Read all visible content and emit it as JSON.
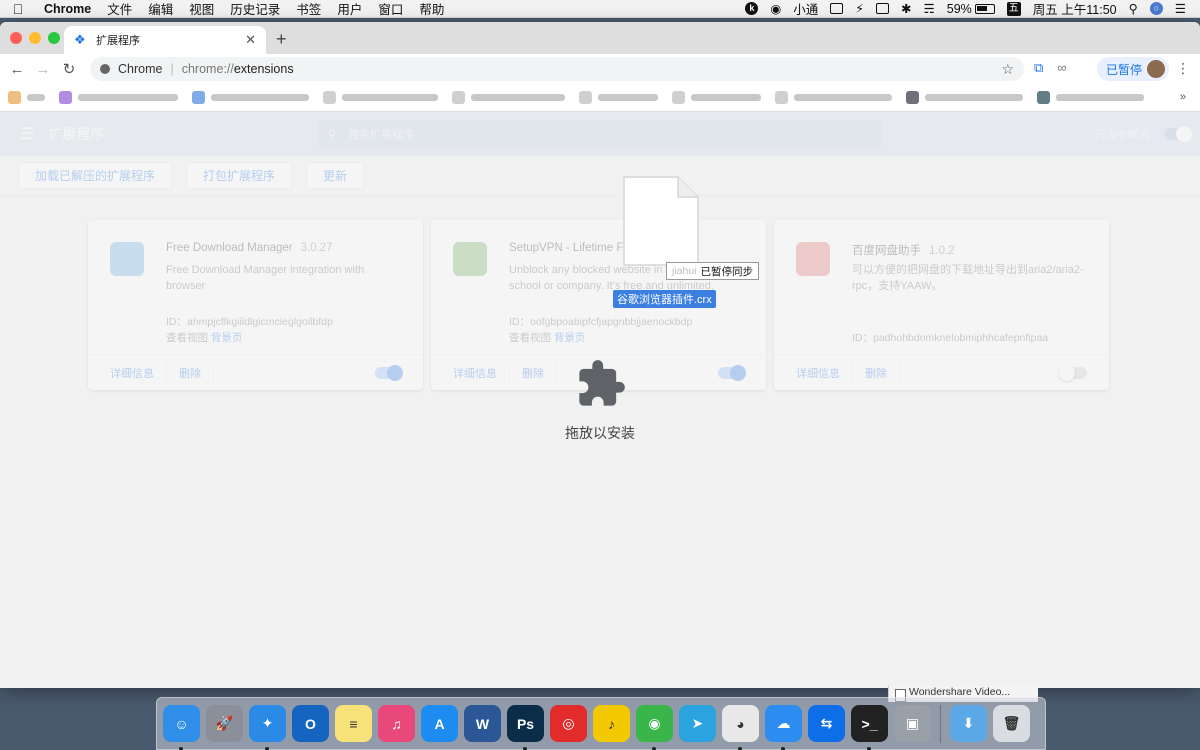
{
  "menubar": {
    "app_name": "Chrome",
    "items": [
      "文件",
      "编辑",
      "视图",
      "历史记录",
      "书签",
      "用户",
      "窗口",
      "帮助"
    ],
    "status": {
      "assistant_label": "小通",
      "battery": "59%",
      "ime_char": "五",
      "datetime": "周五 上午11:50"
    }
  },
  "browser": {
    "tab": {
      "title": "扩展程序"
    },
    "omnibox": {
      "chip": "Chrome",
      "url_scheme": "chrome://",
      "url_host": "extensions"
    },
    "profile": {
      "label": "已暂停"
    },
    "bookmarks_overflow": "»"
  },
  "extensions_page": {
    "header_title": "扩展程序",
    "search_placeholder": "搜索扩展程序",
    "developer_mode_label": "开发者模式",
    "actions": [
      "加载已解压的扩展程序",
      "打包扩展程序",
      "更新"
    ],
    "cards": [
      {
        "name": "Free Download Manager",
        "version": "3.0.27",
        "description": "Free Download Manager integration with browser",
        "id": "ID：ahmpjcflkgiildlgicmcieglgoilbfdp",
        "view_label": "查看视图",
        "view_link": "背景页",
        "details": "详细信息",
        "remove": "删除",
        "enabled": true,
        "icon_color": "#5aa6e0"
      },
      {
        "name": "SetupVPN - Lifetime Free VPN",
        "version": "",
        "description": "Unblock any blocked website in your country, school or company. It's free and unlimited.",
        "id": "ID：oofgbpoabipfcfjapgnbbjjaenockbdp",
        "view_label": "查看视图",
        "view_link": "背景页",
        "details": "详细信息",
        "remove": "删除",
        "enabled": true,
        "icon_color": "#6aa84f"
      },
      {
        "name": "百度网盘助手",
        "version": "1.0.2",
        "description": "可以方便的把网盘的下载地址导出到aria2/aria2-rpc，支持YAAW。",
        "id": "ID：padhohbdomknelobmiphhcafepnfipaa",
        "view_label": "",
        "view_link": "",
        "details": "详细信息",
        "remove": "删除",
        "enabled": false,
        "icon_color": "#e06666"
      }
    ]
  },
  "drop_overlay": {
    "label": "拖放以安装"
  },
  "drag": {
    "filename": "谷歌浏览器插件.crx",
    "tooltip_faded": "jiahui",
    "tooltip_text": "已暂停同步"
  },
  "notification": {
    "text": "Wondershare Video..."
  },
  "dock": {
    "items": [
      {
        "name": "finder",
        "color": "#2f8fe8",
        "glyph": "☺",
        "running": true
      },
      {
        "name": "launchpad",
        "color": "#8a8f99",
        "glyph": "🚀",
        "running": false
      },
      {
        "name": "safari",
        "color": "#2b8ae6",
        "glyph": "✦",
        "running": true
      },
      {
        "name": "outlook",
        "color": "#1565c0",
        "glyph": "O",
        "running": false
      },
      {
        "name": "notes",
        "color": "#f7e27a",
        "glyph": "≡",
        "running": false
      },
      {
        "name": "itunes",
        "color": "#e9487a",
        "glyph": "♫",
        "running": false
      },
      {
        "name": "app-store",
        "color": "#1d8cf0",
        "glyph": "A",
        "running": false
      },
      {
        "name": "word",
        "color": "#2b5797",
        "glyph": "W",
        "running": false
      },
      {
        "name": "photoshop",
        "color": "#0b2d4a",
        "glyph": "Ps",
        "running": true
      },
      {
        "name": "netease-music",
        "color": "#e22b2b",
        "glyph": "◎",
        "running": false
      },
      {
        "name": "qq-music",
        "color": "#f2c800",
        "glyph": "♪",
        "running": false
      },
      {
        "name": "wechat",
        "color": "#39b54a",
        "glyph": "◉",
        "running": true
      },
      {
        "name": "telegram",
        "color": "#2aa3df",
        "glyph": "➤",
        "running": false
      },
      {
        "name": "chrome",
        "color": "#e8e8e8",
        "glyph": "◕",
        "running": true
      },
      {
        "name": "cloud-drive",
        "color": "#2d8cf0",
        "glyph": "☁",
        "running": true
      },
      {
        "name": "teamviewer",
        "color": "#0e6ee8",
        "glyph": "⇆",
        "running": false
      },
      {
        "name": "terminal",
        "color": "#222222",
        "glyph": ">_",
        "running": true
      },
      {
        "name": "preview",
        "color": "#9aa0a8",
        "glyph": "▣",
        "running": false
      }
    ],
    "trailing": [
      {
        "name": "downloads-folder",
        "color": "#5aa9e6",
        "glyph": "⬇"
      },
      {
        "name": "trash",
        "color": "#d9dde2",
        "glyph": "🗑"
      }
    ]
  }
}
